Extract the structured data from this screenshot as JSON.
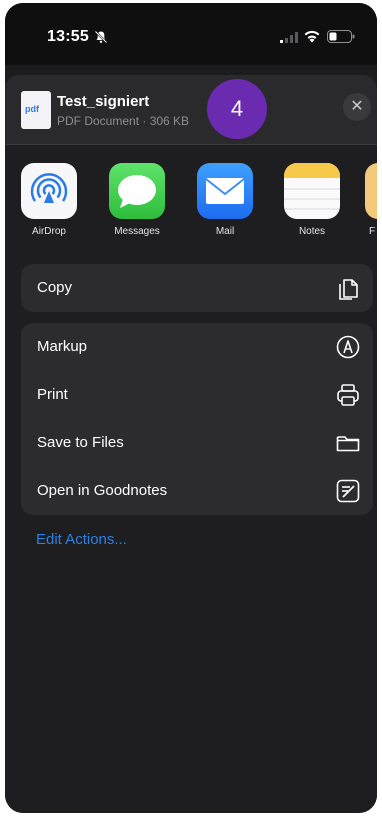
{
  "status": {
    "time": "13:55"
  },
  "file": {
    "icon_text": "pdf",
    "title": "Test_signiert",
    "meta": "PDF Document · 306 KB"
  },
  "badge": {
    "text": "4"
  },
  "close": {
    "symbol": "✕"
  },
  "apps": [
    {
      "label": "AirDrop"
    },
    {
      "label": "Messages"
    },
    {
      "label": "Mail"
    },
    {
      "label": "Notes"
    },
    {
      "label": "F"
    }
  ],
  "actions_primary": [
    {
      "label": "Copy",
      "icon": "copy-icon"
    }
  ],
  "actions_secondary": [
    {
      "label": "Markup",
      "icon": "markup-icon"
    },
    {
      "label": "Print",
      "icon": "printer-icon"
    },
    {
      "label": "Save to Files",
      "icon": "folder-icon"
    },
    {
      "label": "Open in Goodnotes",
      "icon": "goodnotes-icon"
    }
  ],
  "edit_actions": "Edit Actions...",
  "colors": {
    "accent": "#2f7fe0",
    "badge": "#6b2bb0",
    "sheet": "#1e1e20",
    "group": "#2c2c2e"
  }
}
